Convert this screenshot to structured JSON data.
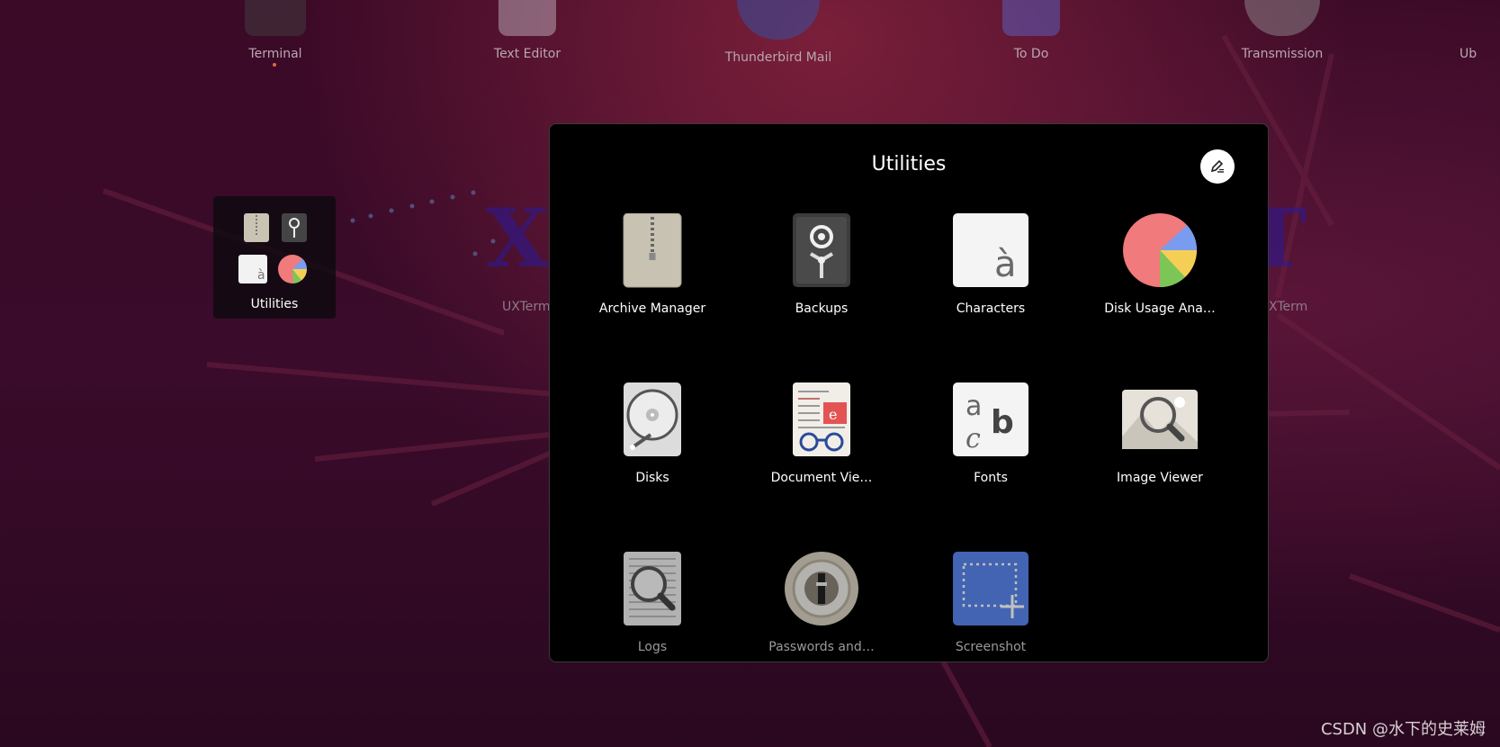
{
  "top_dock": [
    {
      "label": "Terminal"
    },
    {
      "label": "Text Editor"
    },
    {
      "label": "Thunderbird Mail"
    },
    {
      "label": "To Do"
    },
    {
      "label": "Transmission"
    },
    {
      "label": "Ub"
    }
  ],
  "folder": {
    "label": "Utilities"
  },
  "background_apps": [
    {
      "label": "UXTerm"
    },
    {
      "label": "XTerm"
    }
  ],
  "dialog": {
    "title": "Utilities",
    "edit_icon": "edit-pen-icon",
    "apps": [
      {
        "name": "Archive Manager",
        "icon": "archive-icon"
      },
      {
        "name": "Backups",
        "icon": "safe-icon"
      },
      {
        "name": "Characters",
        "icon": "characters-icon"
      },
      {
        "name": "Disk Usage Ana…",
        "icon": "pie-chart-icon"
      },
      {
        "name": "Disks",
        "icon": "disk-icon"
      },
      {
        "name": "Document Vie…",
        "icon": "document-viewer-icon"
      },
      {
        "name": "Fonts",
        "icon": "fonts-icon"
      },
      {
        "name": "Image Viewer",
        "icon": "image-viewer-icon"
      },
      {
        "name": "Logs",
        "icon": "logs-icon"
      },
      {
        "name": "Passwords and…",
        "icon": "passwords-icon"
      },
      {
        "name": "Screenshot",
        "icon": "screenshot-icon"
      }
    ]
  },
  "watermark": "CSDN @水下的史莱姆"
}
